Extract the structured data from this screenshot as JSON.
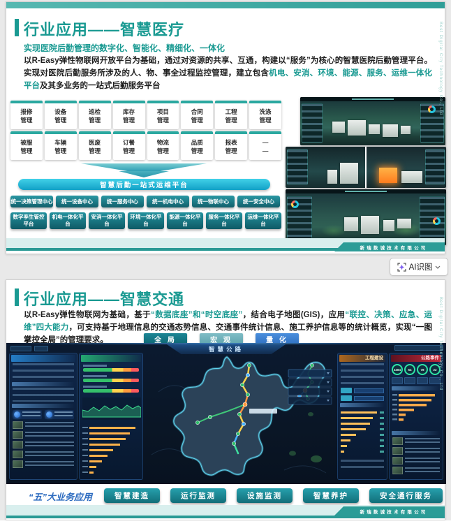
{
  "colors": {
    "accent_teal": "#1a9a92",
    "slide_strip_teal": "#2f9e97",
    "view_global": "#147687",
    "view_macro": "#6cb0ba",
    "view_quant": "#3c7fd2",
    "gauge_green": "#2ee6a6",
    "ai_icon_purple": "#7b5cf0"
  },
  "slide1": {
    "title": "行业应用——智慧医疗",
    "subtitle": "实现医院后勤管理的数字化、智能化、精细化、一体化",
    "paragraph": [
      {
        "t": "以R-Easy弹性物联网开放平台为基础，通过对资源的共享、互通，构建以“服务”为核心的智慧医院后勤管理平台。实现对医院后勤服务所涉及的人、物、事全过程监控管理，建立包含",
        "c": ""
      },
      {
        "t": "机电、安消、环境、能源、服务、运维一体化平台",
        "c": "hl"
      },
      {
        "t": "及其多业务的一站式后勤服务平台",
        "c": ""
      }
    ],
    "modules": [
      {
        "a": "报修",
        "b": "管理"
      },
      {
        "a": "设备",
        "b": "管理"
      },
      {
        "a": "巡检",
        "b": "管理"
      },
      {
        "a": "库存",
        "b": "管理"
      },
      {
        "a": "项目",
        "b": "管理"
      },
      {
        "a": "合同",
        "b": "管理"
      },
      {
        "a": "工程",
        "b": "管理"
      },
      {
        "a": "洗涤",
        "b": "管理"
      },
      {
        "a": "被服",
        "b": "管理"
      },
      {
        "a": "车辆",
        "b": "管理"
      },
      {
        "a": "医废",
        "b": "管理"
      },
      {
        "a": "订餐",
        "b": "管理"
      },
      {
        "a": "物流",
        "b": "管理"
      },
      {
        "a": "品质",
        "b": "管理"
      },
      {
        "a": "报表",
        "b": "管理"
      },
      {
        "a": "—",
        "b": "—"
      }
    ],
    "platform_bar": "智慧后勤一站式运维平台",
    "centers": [
      "统一决策管理中心",
      "统一设备中心",
      "统一服务中心",
      "统一机电中心",
      "统一物联中心",
      "统一安全中心"
    ],
    "platforms": [
      "数字孪生管控平台",
      "机电一体化平台",
      "安消一体化平台",
      "环境一体化平台",
      "能源一体化平台",
      "服务一体化平台",
      "运维一体化平台"
    ],
    "footer_company": "新瑞数城技术有限公司",
    "side_text": "Best Digital City Technology Co., Ltd"
  },
  "ai_button": {
    "label": "AI识图"
  },
  "slide2": {
    "title": "行业应用——智慧交通",
    "paragraph": [
      {
        "t": "以R-Easy弹性物联网为基础，基于",
        "c": ""
      },
      {
        "t": "“数据底座”和“时空底座”",
        "c": "hl"
      },
      {
        "t": "，结合电子地图(GIS)，应用",
        "c": ""
      },
      {
        "t": "“联控、决策、应急、运维”四大能力",
        "c": "hl"
      },
      {
        "t": "，可支持基于地理信息的交通态势信息、交通事件统计信息、施工养护信息等的统计概览，实现",
        "c": ""
      },
      {
        "t": "“一图掌控全局”",
        "c": "bd"
      },
      {
        "t": "的管理要求。",
        "c": ""
      }
    ],
    "view_buttons": {
      "global": "全 局",
      "macro": "宏 观",
      "quant": "量 化"
    },
    "dashboard": {
      "header": "智慧公路",
      "panel_construction": "工程建设",
      "panel_events": "公路事件",
      "gauges": [
        "4384",
        "54",
        "78",
        "22"
      ]
    },
    "bottom": {
      "prefix": "“五”大业务应用",
      "buttons": [
        "智慧建造",
        "运行监测",
        "设施监测",
        "智慧养护",
        "安全通行服务"
      ]
    },
    "footer_company": "新瑞数城技术有限公司",
    "side_text": "Best Digital City Technology Co., Ltd"
  }
}
